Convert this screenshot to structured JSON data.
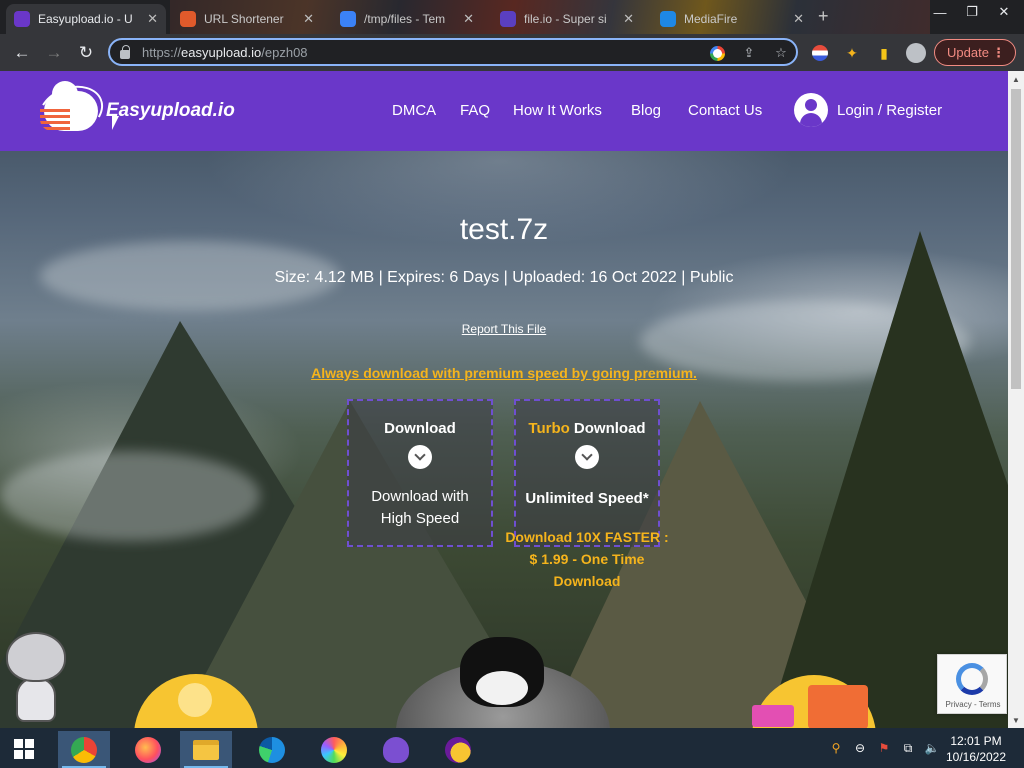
{
  "browser": {
    "tabs": [
      {
        "title": "Easyupload.io - U",
        "fav_color": "#6a37c9",
        "active": true
      },
      {
        "title": "URL Shortener",
        "fav_color": "#e05a2b",
        "active": false
      },
      {
        "title": "/tmp/files - Tem",
        "fav_color": "#3b82f6",
        "active": false
      },
      {
        "title": "file.io - Super si",
        "fav_color": "#5a3fc0",
        "active": false
      },
      {
        "title": "MediaFire",
        "fav_color": "#1e88e5",
        "active": false
      }
    ],
    "url_scheme": "https://",
    "url_host": "easyupload.io",
    "url_path": "/epzh08",
    "update_label": "Update"
  },
  "site": {
    "logo_text": "Easyupload.io",
    "nav": [
      "DMCA",
      "FAQ",
      "How It Works",
      "Blog",
      "Contact Us"
    ],
    "login_label": "Login / Register",
    "header_color": "#6a37c9"
  },
  "file": {
    "name": "test.7z",
    "meta": "Size: 4.12 MB | Expires: 6 Days | Uploaded: 16 Oct 2022 | Public",
    "report_label": "Report This File",
    "premium_link": "Always download with premium speed by going premium."
  },
  "download": {
    "free": {
      "title": "Download",
      "subtitle": "Download with High Speed"
    },
    "turbo": {
      "title_accent": "Turbo",
      "title_rest": " Download",
      "subtitle": "Unlimited Speed*",
      "note": "Download 10X FASTER : $ 1.99 - One Time Download"
    }
  },
  "recaptcha": {
    "terms": "Privacy - Terms"
  },
  "taskbar": {
    "apps": [
      "chrome-icon",
      "firefox-icon",
      "file-explorer-icon",
      "edge-icon",
      "photos-icon",
      "bonzi-icon",
      "yahoo-messenger-icon"
    ],
    "time": "12:01 PM",
    "date": "10/16/2022"
  }
}
